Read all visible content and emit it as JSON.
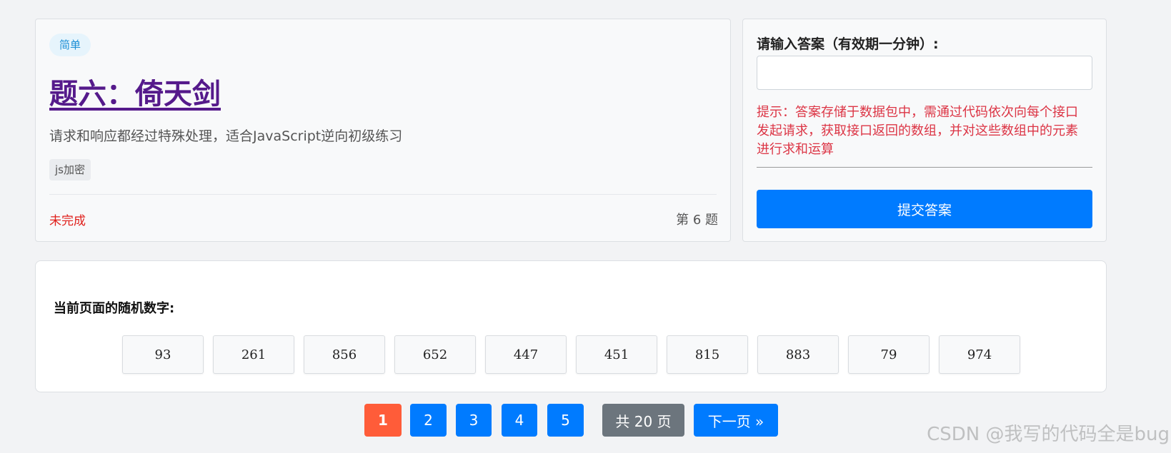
{
  "problem": {
    "difficulty": "简单",
    "title": "题六：倚天剑",
    "description": "请求和响应都经过特殊处理，适合JavaScript逆向初级练习",
    "tag": "js加密",
    "status": "未完成",
    "question_number": "第 6 题"
  },
  "answer": {
    "label": "请输入答案（有效期一分钟）:",
    "input_value": "",
    "input_placeholder": "",
    "hint": "提示：答案存储于数据包中，需通过代码依次向每个接口发起请求，获取接口返回的数组，并对这些数组中的元素进行求和运算",
    "submit_label": "提交答案"
  },
  "random_numbers": {
    "label": "当前页面的随机数字:",
    "values": [
      "93",
      "261",
      "856",
      "652",
      "447",
      "451",
      "815",
      "883",
      "79",
      "974"
    ]
  },
  "pagination": {
    "pages": [
      "1",
      "2",
      "3",
      "4",
      "5"
    ],
    "active_page": "1",
    "total_label": "共 20 页",
    "next_label": "下一页 »"
  },
  "watermark": "CSDN @我写的代码全是bug",
  "colors": {
    "primary": "#007bff",
    "active_page": "#ff5c39",
    "total_badge": "#6c757d",
    "hint_red": "#dc3545",
    "status_red": "#e0201b",
    "title_purple": "#551a8b",
    "difficulty_blue": "#1d8fd6"
  }
}
